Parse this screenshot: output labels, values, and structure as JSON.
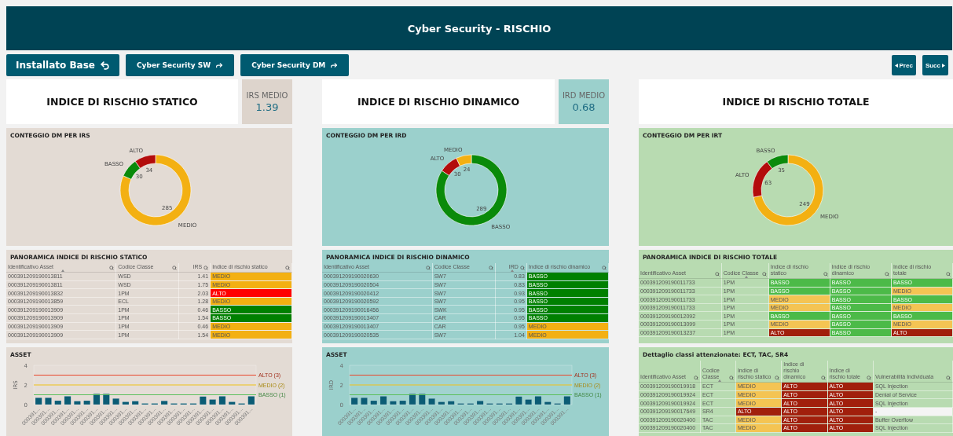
{
  "header": {
    "title": "Cyber Security - RISCHIO"
  },
  "nav": {
    "buttons": [
      {
        "label": "Installato Base",
        "kind": "back"
      },
      {
        "label": "Cyber Security SW",
        "kind": "forward"
      },
      {
        "label": "Cyber Security DM",
        "kind": "forward"
      }
    ],
    "pager": [
      {
        "label": "Prec",
        "kind": "prev"
      },
      {
        "label": "Succ",
        "kind": "next"
      }
    ]
  },
  "columns": [
    {
      "index_title": "INDICE DI RISCHIO STATICO",
      "kpi": {
        "label": "IRS MEDIO",
        "value": "1.39"
      },
      "donut": {
        "title": "CONTEGGIO DM PER IRS",
        "chart_data": {
          "type": "donut",
          "categories": [
            "MEDIO",
            "BASSO",
            "ALTO"
          ],
          "values": [
            285,
            30,
            34
          ],
          "colors": [
            "#f3b012",
            "#0a8a0a",
            "#b30c0c"
          ],
          "data_labels": true
        }
      },
      "table": {
        "title": "PANORAMICA INDICE DI RISCHIO STATICO",
        "columns": [
          {
            "label": "Identificativo Asset",
            "kind": "id",
            "sorted": true
          },
          {
            "label": "Codice Classe",
            "kind": "class",
            "sorted": false
          },
          {
            "label": "IRS",
            "kind": "number",
            "sorted": false
          },
          {
            "label": "Indice di rischio statico",
            "kind": "risk",
            "sorted": false
          }
        ],
        "rows": [
          {
            "cells": [
              "000391209190013811",
              "WSD",
              "1.41",
              {
                "text": "MEDIO",
                "color": "#f3b012"
              }
            ]
          },
          {
            "cells": [
              "000391209190013811",
              "WSD",
              "1.75",
              {
                "text": "MEDIO",
                "color": "#f3b012"
              }
            ]
          },
          {
            "cells": [
              "000391209190013832",
              "1PM",
              "2.03",
              {
                "text": "ALTO",
                "color": "#ff0000"
              }
            ]
          },
          {
            "cells": [
              "000391209190013859",
              "ECL",
              "1.28",
              {
                "text": "MEDIO",
                "color": "#f3b012"
              }
            ]
          },
          {
            "cells": [
              "000391209190013909",
              "1PM",
              "0.46",
              {
                "text": "BASSO",
                "color": "#008000"
              }
            ]
          },
          {
            "cells": [
              "000391209190013909",
              "1PM",
              "1.54",
              {
                "text": "BASSO",
                "color": "#008000"
              }
            ]
          },
          {
            "cells": [
              "000391209190013909",
              "1PM",
              "0.46",
              {
                "text": "MEDIO",
                "color": "#f3b012"
              }
            ]
          },
          {
            "cells": [
              "000391209190013909",
              "1PM",
              "1.54",
              {
                "text": "MEDIO",
                "color": "#f3b012"
              }
            ]
          }
        ]
      },
      "bottom": {
        "kind": "chart",
        "title": "ASSET",
        "chart_data": {
          "type": "bar",
          "ylabel": "IRS",
          "categories": [
            "000391...",
            "000391...",
            "000391...",
            "000391...",
            "000391...",
            "000391...",
            "000391...",
            "000391...",
            "000391...",
            "000391...",
            "000391...",
            "000391...",
            "000391...",
            "000391...",
            "000391...",
            "000391...",
            "000391...",
            "000391...",
            "000391...",
            "000391...",
            "000391...",
            "000391...",
            "000391..."
          ],
          "values": [
            0.7,
            0.7,
            0.4,
            0.85,
            0.35,
            0.4,
            1.1,
            1.1,
            0.62,
            0.28,
            0.35,
            0.12,
            0.12,
            0.38,
            0.12,
            0.12,
            0.12,
            0.82,
            0.52,
            0.85,
            0.28,
            0.12,
            0.85
          ],
          "ylim": [
            0,
            4
          ],
          "yticks": [
            0,
            2,
            4
          ],
          "ref_lines": [
            {
              "axis": "y",
              "value": 3,
              "label": "ALTO (3)",
              "color": "#e8452a"
            },
            {
              "axis": "y",
              "value": 2,
              "label": "MEDIO (2)",
              "color": "#f0c419"
            },
            {
              "axis": "y",
              "value": 1,
              "label": "BASSO (1)",
              "color": "#5cc05c"
            }
          ]
        }
      }
    },
    {
      "index_title": "INDICE DI RISCHIO DINAMICO",
      "kpi": {
        "label": "IRD MEDIO",
        "value": "0.68"
      },
      "donut": {
        "title": "CONTEGGIO DM PER IRD",
        "chart_data": {
          "type": "donut",
          "categories": [
            "BASSO",
            "ALTO",
            "MEDIO"
          ],
          "values": [
            289,
            30,
            24
          ],
          "colors": [
            "#0a8a0a",
            "#b30c0c",
            "#f3b012"
          ],
          "data_labels": true
        }
      },
      "table": {
        "title": "PANORAMICA INDICE DI RISCHIO DINAMICO",
        "columns": [
          {
            "label": "Identificativo Asset",
            "kind": "id",
            "sorted": false
          },
          {
            "label": "Codice Classe",
            "kind": "class",
            "sorted": false
          },
          {
            "label": "IRD",
            "kind": "number",
            "sorted": true
          },
          {
            "label": "Indice di rischio dinamico",
            "kind": "risk",
            "sorted": false
          }
        ],
        "rows": [
          {
            "cells": [
              "000391209190020630",
              "SW7",
              "0.83",
              {
                "text": "BASSO",
                "color": "#008000"
              }
            ]
          },
          {
            "cells": [
              "000391209190020504",
              "SW7",
              "0.83",
              {
                "text": "BASSO",
                "color": "#008000"
              }
            ]
          },
          {
            "cells": [
              "000391209190020412",
              "SW7",
              "0.93",
              {
                "text": "BASSO",
                "color": "#008000"
              }
            ]
          },
          {
            "cells": [
              "000391209190020592",
              "SW7",
              "0.95",
              {
                "text": "BASSO",
                "color": "#008000"
              }
            ]
          },
          {
            "cells": [
              "000391209190016456",
              "SWK",
              "0.95",
              {
                "text": "BASSO",
                "color": "#008000"
              }
            ]
          },
          {
            "cells": [
              "000391209190013407",
              "CAR",
              "0.95",
              {
                "text": "BASSO",
                "color": "#008000"
              }
            ]
          },
          {
            "cells": [
              "000391209190013407",
              "CAR",
              "0.95",
              {
                "text": "MEDIO",
                "color": "#f3b012"
              }
            ]
          },
          {
            "cells": [
              "000391209190020535",
              "SW7",
              "1.04",
              {
                "text": "MEDIO",
                "color": "#f3b012"
              }
            ]
          }
        ]
      },
      "bottom": {
        "kind": "chart",
        "title": "ASSET",
        "chart_data": {
          "type": "bar",
          "ylabel": "IRD",
          "categories": [
            "000391...",
            "000391...",
            "000391...",
            "000391...",
            "000391...",
            "000391...",
            "000391...",
            "000391...",
            "000391...",
            "000391...",
            "000391...",
            "000391...",
            "000391...",
            "000391...",
            "000391...",
            "000391...",
            "000391...",
            "000391...",
            "000391...",
            "000391...",
            "000391...",
            "000391...",
            "000391..."
          ],
          "values": [
            0.7,
            0.7,
            0.4,
            0.85,
            0.35,
            0.4,
            1.1,
            1.1,
            0.62,
            0.28,
            0.35,
            0.12,
            0.12,
            0.38,
            0.12,
            0.12,
            0.12,
            0.82,
            0.52,
            0.85,
            0.28,
            0.12,
            0.85
          ],
          "ylim": [
            0,
            4
          ],
          "yticks": [
            0,
            2,
            4
          ],
          "ref_lines": [
            {
              "axis": "y",
              "value": 3,
              "label": "ALTO (3)",
              "color": "#e8452a"
            },
            {
              "axis": "y",
              "value": 2,
              "label": "MEDIO (2)",
              "color": "#f0c419"
            },
            {
              "axis": "y",
              "value": 1,
              "label": "BASSO (1)",
              "color": "#5cc05c"
            }
          ]
        }
      }
    },
    {
      "index_title": "INDICE DI RISCHIO TOTALE",
      "donut": {
        "title": "CONTEGGIO DM PER IRT",
        "chart_data": {
          "type": "donut",
          "categories": [
            "MEDIO",
            "ALTO",
            "BASSO"
          ],
          "values": [
            249,
            63,
            35
          ],
          "colors": [
            "#f3b012",
            "#b30c0c",
            "#0a8a0a"
          ],
          "data_labels": true
        }
      },
      "table": {
        "title": "PANORAMICA INDICE DI RISCHIO TOTALE",
        "columns": [
          {
            "label": "Identificativo Asset",
            "kind": "id",
            "sorted": false
          },
          {
            "label": "Codice Classe",
            "kind": "class",
            "sorted": true
          },
          {
            "label": "Indice di rischio statico",
            "kind": "risk",
            "sorted": false
          },
          {
            "label": "Indice di rischio dinamico",
            "kind": "risk",
            "sorted": false
          },
          {
            "label": "Indice di rischio totale",
            "kind": "risk",
            "sorted": false
          }
        ],
        "rows": [
          {
            "cells": [
              "000391209190011733",
              "1PM",
              {
                "text": "BASSO",
                "color": "#4cba48"
              },
              {
                "text": "BASSO",
                "color": "#4cba48"
              },
              {
                "text": "BASSO",
                "color": "#4cba48"
              }
            ]
          },
          {
            "cells": [
              "000391209190011733",
              "1PM",
              {
                "text": "BASSO",
                "color": "#4cba48"
              },
              {
                "text": "BASSO",
                "color": "#4cba48"
              },
              {
                "text": "MEDIO",
                "color": "#f4c453"
              }
            ]
          },
          {
            "cells": [
              "000391209190011733",
              "1PM",
              {
                "text": "MEDIO",
                "color": "#f4c453"
              },
              {
                "text": "BASSO",
                "color": "#4cba48"
              },
              {
                "text": "BASSO",
                "color": "#4cba48"
              }
            ]
          },
          {
            "cells": [
              "000391209190011733",
              "1PM",
              {
                "text": "MEDIO",
                "color": "#f4c453"
              },
              {
                "text": "BASSO",
                "color": "#4cba48"
              },
              {
                "text": "MEDIO",
                "color": "#f4c453"
              }
            ]
          },
          {
            "cells": [
              "000391209190012092",
              "1PM",
              {
                "text": "BASSO",
                "color": "#4cba48"
              },
              {
                "text": "BASSO",
                "color": "#4cba48"
              },
              {
                "text": "BASSO",
                "color": "#4cba48"
              }
            ]
          },
          {
            "cells": [
              "000391209190013099",
              "1PM",
              {
                "text": "MEDIO",
                "color": "#f4c453"
              },
              {
                "text": "BASSO",
                "color": "#4cba48"
              },
              {
                "text": "MEDIO",
                "color": "#f4c453"
              }
            ]
          },
          {
            "cells": [
              "000391209190013237",
              "1PM",
              {
                "text": "ALTO",
                "color": "#a11f0c"
              },
              {
                "text": "BASSO",
                "color": "#4cba48"
              },
              {
                "text": "ALTO",
                "color": "#a11f0c"
              }
            ]
          }
        ]
      },
      "bottom": {
        "kind": "table",
        "title": "Dettaglio classi attenzionate: ECT, TAC, SR4",
        "columns": [
          {
            "label": "Identificativo Asset",
            "kind": "id",
            "sorted": false
          },
          {
            "label": "Codice Classe",
            "kind": "class",
            "sorted": true
          },
          {
            "label": "Indice di rischio statico",
            "kind": "risk",
            "sorted": false
          },
          {
            "label": "Indice di rischio dinamico",
            "kind": "risk",
            "sorted": false
          },
          {
            "label": "Indice di rischio totale",
            "kind": "risk",
            "sorted": false
          },
          {
            "label": "Vulnerabilità Individuata",
            "kind": "text",
            "sorted": false
          }
        ],
        "rows": [
          {
            "cells": [
              "000391209190019918",
              "ECT",
              {
                "text": "MEDIO",
                "color": "#f4c453"
              },
              {
                "text": "ALTO",
                "color": "#a11f0c"
              },
              {
                "text": "ALTO",
                "color": "#a11f0c"
              },
              "SQL Injection"
            ]
          },
          {
            "cells": [
              "000391209190019924",
              "ECT",
              {
                "text": "MEDIO",
                "color": "#f4c453"
              },
              {
                "text": "ALTO",
                "color": "#a11f0c"
              },
              {
                "text": "ALTO",
                "color": "#a11f0c"
              },
              "Denial of Service"
            ]
          },
          {
            "cells": [
              "000391209190019924",
              "ECT",
              {
                "text": "MEDIO",
                "color": "#f4c453"
              },
              {
                "text": "ALTO",
                "color": "#a11f0c"
              },
              {
                "text": "ALTO",
                "color": "#a11f0c"
              },
              "SQL Injection"
            ]
          },
          {
            "cells": [
              "000391209190017649",
              "SR4",
              {
                "text": "ALTO",
                "color": "#a11f0c"
              },
              {
                "text": "ALTO",
                "color": "#a11f0c"
              },
              {
                "text": "ALTO",
                "color": "#a11f0c"
              },
              {
                "text": "-",
                "color": "#f4f4f4"
              }
            ]
          },
          {
            "cells": [
              "000391209190020400",
              "TAC",
              {
                "text": "MEDIO",
                "color": "#f4c453"
              },
              {
                "text": "ALTO",
                "color": "#a11f0c"
              },
              {
                "text": "ALTO",
                "color": "#a11f0c"
              },
              "Buffer Overflow"
            ]
          },
          {
            "cells": [
              "000391209190020400",
              "TAC",
              {
                "text": "MEDIO",
                "color": "#f4c453"
              },
              {
                "text": "ALTO",
                "color": "#a11f0c"
              },
              {
                "text": "ALTO",
                "color": "#a11f0c"
              },
              "SQL Injection"
            ]
          }
        ]
      }
    }
  ]
}
